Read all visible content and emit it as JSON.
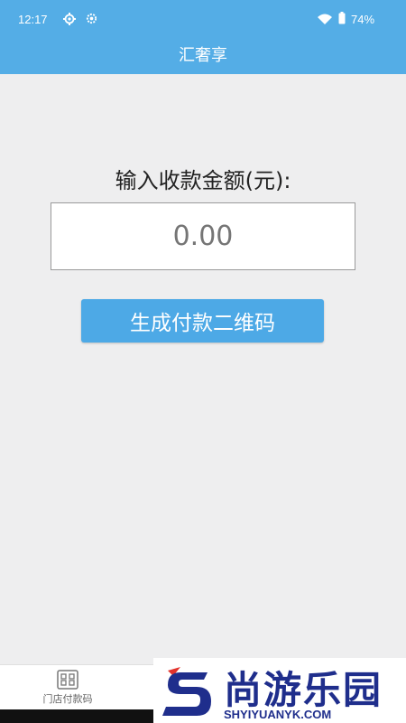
{
  "status_bar": {
    "time": "12:17",
    "battery": "74%",
    "icons": [
      "gear-icon",
      "settings-icon",
      "wifi-icon",
      "battery-icon"
    ]
  },
  "app_bar": {
    "title": "汇奢享"
  },
  "form": {
    "label": "输入收款金额(元):",
    "amount_placeholder": "0.00",
    "button_label": "生成付款二维码"
  },
  "bottom_nav": {
    "tabs": [
      {
        "label": "门店付款码",
        "icon": "qr-grid-icon"
      }
    ]
  },
  "watermark": {
    "title": "尚游乐园",
    "url": "SHYIYUANYK.COM"
  },
  "colors": {
    "primary": "#54ade6",
    "button": "#4da9e6",
    "background": "#eeeeef",
    "watermark": "#1f2e8c",
    "watermark_accent": "#e3322b"
  }
}
